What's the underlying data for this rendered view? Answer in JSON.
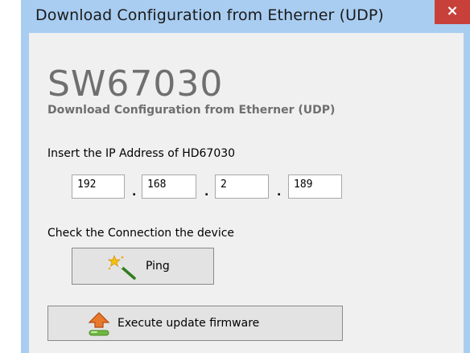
{
  "window": {
    "title": "Download Configuration from Etherner (UDP)",
    "close_glyph": "×"
  },
  "header": {
    "app_name": "SW67030",
    "subtitle": "Download Configuration from Etherner (UDP)"
  },
  "ip_section": {
    "label": "Insert the IP Address of  HD67030",
    "octets": [
      "192",
      "168",
      "2",
      "189"
    ],
    "separator": "."
  },
  "connection_section": {
    "label": "Check the Connection the device",
    "ping_label": "Ping",
    "ping_icon": "magic-wand-icon"
  },
  "firmware": {
    "label": "Execute update firmware",
    "icon": "upload-arrow-icon"
  },
  "colors": {
    "window_frame": "#a9cdf1",
    "client_bg": "#f0f0f0",
    "close_button": "#c7413a",
    "brand_text": "#6f6f6f"
  }
}
